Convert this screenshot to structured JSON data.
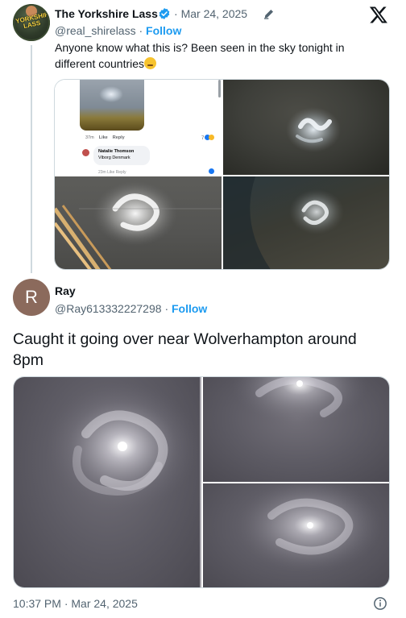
{
  "quoted": {
    "name": "The Yorkshire Lass",
    "date": "Mar 24, 2025",
    "date_sep": "·",
    "handle": "@real_shirelass",
    "follow": "Follow",
    "handle_sep": "·",
    "text": "Anyone know what this is? Been seen in the sky tonight in different countries",
    "avatar_text": "YORKSHIRE LASS",
    "embedded_post": {
      "time": "37m",
      "like": "Like",
      "reply": "Reply",
      "reactions": "7",
      "commenter": "Natalie Thomson",
      "comment": "Viborg Denmark",
      "sub_meta": "23m  Like  Reply",
      "count": "1"
    }
  },
  "reply": {
    "avatar_letter": "R",
    "name": "Ray",
    "handle": "@Ray613332227298",
    "handle_sep": "·",
    "follow": "Follow",
    "text": "Caught it going over near Wolverhampton around 8pm",
    "timestamp": "10:37 PM · Mar 24, 2025"
  },
  "colors": {
    "link": "#1d9bf0",
    "muted": "#536471",
    "avatar_reply": "#8b6a5c"
  },
  "icons": [
    "verified-badge-icon",
    "edit-icon",
    "x-logo-icon",
    "info-icon"
  ]
}
